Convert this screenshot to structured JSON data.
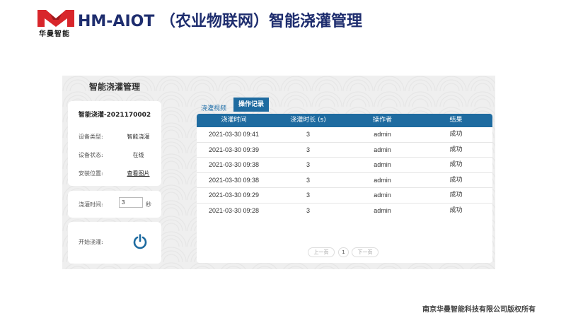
{
  "header": {
    "brand_text": "华曼智能",
    "title": "HM-AIOT （农业物联网）智能浇灌管理"
  },
  "panel": {
    "title": "智能浇灌管理",
    "device": {
      "name": "智能浇灌-2021170002",
      "type_label": "设备类型:",
      "type_value": "智能浇灌",
      "status_label": "设备状态:",
      "status_value": "在线",
      "location_label": "安装位置:",
      "location_link": "查看图片"
    },
    "irrigation_time": {
      "label": "浇灌时间:",
      "value": "3",
      "unit": "秒"
    },
    "start": {
      "label": "开始浇灌:",
      "icon": "power-icon"
    },
    "tabs": [
      {
        "label": "浇灌视频",
        "active": false
      },
      {
        "label": "操作记录",
        "active": true
      }
    ],
    "table": {
      "columns": [
        "浇灌时间",
        "浇灌时长 (s)",
        "操作者",
        "结果"
      ],
      "rows": [
        [
          "2021-03-30 09:41",
          "3",
          "admin",
          "成功"
        ],
        [
          "2021-03-30 09:39",
          "3",
          "admin",
          "成功"
        ],
        [
          "2021-03-30 09:38",
          "3",
          "admin",
          "成功"
        ],
        [
          "2021-03-30 09:38",
          "3",
          "admin",
          "成功"
        ],
        [
          "2021-03-30 09:29",
          "3",
          "admin",
          "成功"
        ],
        [
          "2021-03-30 09:28",
          "3",
          "admin",
          "成功"
        ]
      ]
    },
    "pager": {
      "prev": "上一页",
      "page": "1",
      "next": "下一页"
    }
  },
  "footer": {
    "copyright": "南京华曼智能科技有限公司版权所有"
  },
  "colors": {
    "accent": "#1e6ba0",
    "title": "#1e2d6e",
    "logo_red": "#d8262b"
  }
}
